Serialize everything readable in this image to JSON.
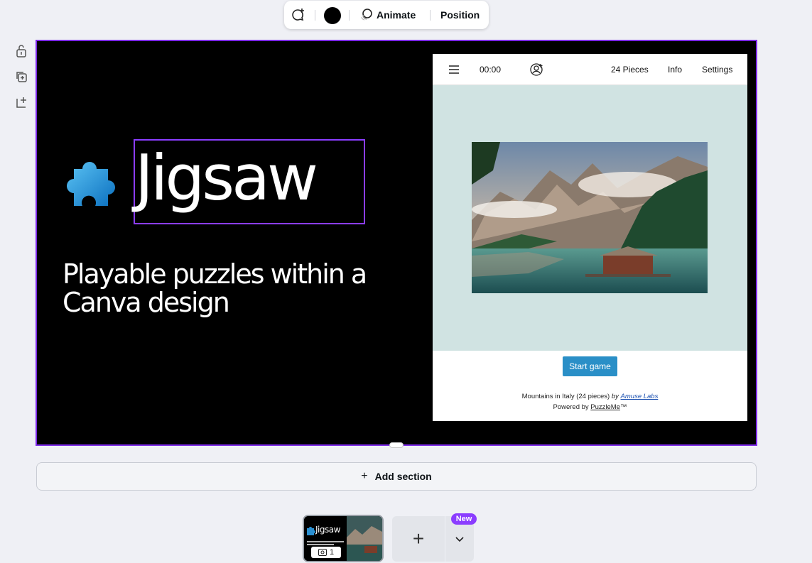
{
  "toolbar": {
    "animate_label": "Animate",
    "position_label": "Position",
    "color_swatch": "#000000"
  },
  "side_icons": [
    "lock-icon",
    "duplicate-icon",
    "add-page-icon"
  ],
  "design": {
    "title": "Jigsaw",
    "subtitle": "Playable puzzles within a Canva design"
  },
  "puzzle_app": {
    "timer": "00:00",
    "pieces": "24 Pieces",
    "info": "Info",
    "settings": "Settings",
    "start_button": "Start game",
    "credit_prefix": "Mountains in Italy (24 pieces)",
    "credit_by": "by",
    "credit_author": "Amuse Labs",
    "powered_prefix": "Powered by",
    "powered_brand": "PuzzleMe",
    "powered_tm": "™"
  },
  "add_section": {
    "label": "Add section",
    "icon": "+"
  },
  "pages": {
    "thumb_title": "Jigsaw",
    "thumb_number": "1",
    "add_icon": "+",
    "new_badge": "New"
  },
  "colors": {
    "accent": "#8b3dff",
    "selection_border": "#7d2ae8",
    "start_button": "#2a8fc7",
    "puzzle_area": "#d0e3e2"
  }
}
